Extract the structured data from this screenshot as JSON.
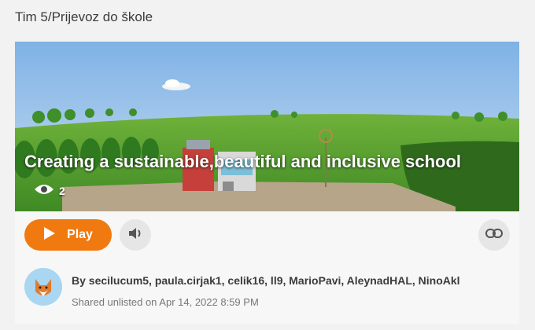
{
  "page": {
    "title": "Tim 5/Prijevoz do škole"
  },
  "project": {
    "overlay_title": "Creating a sustainable,beautiful and inclusive school",
    "views": "2"
  },
  "controls": {
    "play_label": "Play"
  },
  "author": {
    "by_line": "By secilucum5, paula.cirjak1, celik16, ll9, MarioPavi, AleynadHAL, NinoAkl",
    "shared_text": "Shared unlisted on Apr 14, 2022 8:59 PM"
  },
  "colors": {
    "accent": "#f07a10",
    "background": "#f2f2f2",
    "card": "#ffffff"
  },
  "icons": {
    "views": "eye-icon",
    "play": "play-icon",
    "sound": "speaker-icon",
    "link": "link-icon",
    "avatar": "fox-avatar-icon"
  }
}
